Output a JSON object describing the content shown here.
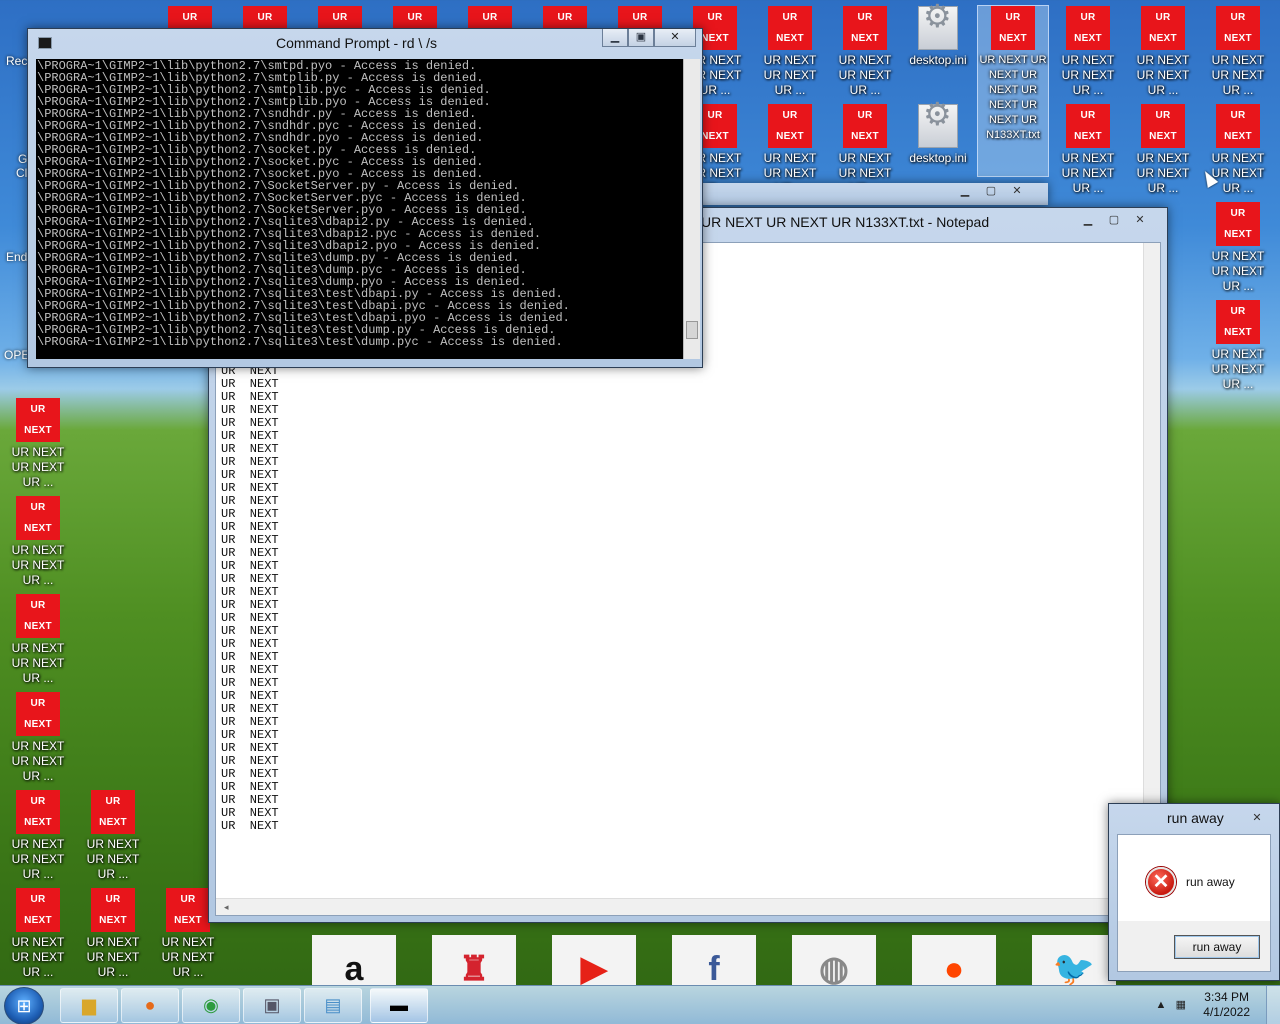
{
  "desktop": {
    "icon_label_red": "UR NEXT UR NEXT UR ...",
    "icon_text_top": "UR",
    "icon_text_bottom": "NEXT",
    "desktop_ini": "desktop.ini",
    "tall_label": "UR NEXT UR NEXT UR NEXT UR NEXT UR NEXT UR N133XT.txt",
    "partial_label_bottom_right": "UR NE NEXT",
    "edge_labels": [
      "Rec",
      "G",
      "Cl",
      "End",
      "OPE"
    ]
  },
  "cmd": {
    "title": "Command Prompt - rd  \\ /s",
    "lines": [
      "\\PROGRA~1\\GIMP2~1\\lib\\python2.7\\smtpd.pyo - Access is denied.",
      "\\PROGRA~1\\GIMP2~1\\lib\\python2.7\\smtplib.py - Access is denied.",
      "\\PROGRA~1\\GIMP2~1\\lib\\python2.7\\smtplib.pyc - Access is denied.",
      "\\PROGRA~1\\GIMP2~1\\lib\\python2.7\\smtplib.pyo - Access is denied.",
      "\\PROGRA~1\\GIMP2~1\\lib\\python2.7\\sndhdr.py - Access is denied.",
      "\\PROGRA~1\\GIMP2~1\\lib\\python2.7\\sndhdr.pyc - Access is denied.",
      "\\PROGRA~1\\GIMP2~1\\lib\\python2.7\\sndhdr.pyo - Access is denied.",
      "\\PROGRA~1\\GIMP2~1\\lib\\python2.7\\socket.py - Access is denied.",
      "\\PROGRA~1\\GIMP2~1\\lib\\python2.7\\socket.pyc - Access is denied.",
      "\\PROGRA~1\\GIMP2~1\\lib\\python2.7\\socket.pyo - Access is denied.",
      "\\PROGRA~1\\GIMP2~1\\lib\\python2.7\\SocketServer.py - Access is denied.",
      "\\PROGRA~1\\GIMP2~1\\lib\\python2.7\\SocketServer.pyc - Access is denied.",
      "\\PROGRA~1\\GIMP2~1\\lib\\python2.7\\SocketServer.pyo - Access is denied.",
      "\\PROGRA~1\\GIMP2~1\\lib\\python2.7\\sqlite3\\dbapi2.py - Access is denied.",
      "\\PROGRA~1\\GIMP2~1\\lib\\python2.7\\sqlite3\\dbapi2.pyc - Access is denied.",
      "\\PROGRA~1\\GIMP2~1\\lib\\python2.7\\sqlite3\\dbapi2.pyo - Access is denied.",
      "\\PROGRA~1\\GIMP2~1\\lib\\python2.7\\sqlite3\\dump.py - Access is denied.",
      "\\PROGRA~1\\GIMP2~1\\lib\\python2.7\\sqlite3\\dump.pyc - Access is denied.",
      "\\PROGRA~1\\GIMP2~1\\lib\\python2.7\\sqlite3\\dump.pyo - Access is denied.",
      "\\PROGRA~1\\GIMP2~1\\lib\\python2.7\\sqlite3\\test\\dbapi.py - Access is denied.",
      "\\PROGRA~1\\GIMP2~1\\lib\\python2.7\\sqlite3\\test\\dbapi.pyc - Access is denied.",
      "\\PROGRA~1\\GIMP2~1\\lib\\python2.7\\sqlite3\\test\\dbapi.pyo - Access is denied.",
      "\\PROGRA~1\\GIMP2~1\\lib\\python2.7\\sqlite3\\test\\dump.py - Access is denied.",
      "\\PROGRA~1\\GIMP2~1\\lib\\python2.7\\sqlite3\\test\\dump.pyc - Access is denied."
    ]
  },
  "notepad": {
    "title": "UR NEXT UR NEXT UR N133XT.txt - Notepad",
    "line_text": "UR  NEXT",
    "visible_line_count": 36
  },
  "dialog": {
    "title": "run away",
    "message": "run away",
    "button": "run away"
  },
  "dock": {
    "items": [
      {
        "name": "amazon",
        "glyph": "a",
        "color": "#111111"
      },
      {
        "name": "castle",
        "glyph": "♜",
        "color": "#d4232e"
      },
      {
        "name": "youtube",
        "glyph": "▶",
        "color": "#e62117"
      },
      {
        "name": "facebook",
        "glyph": "f",
        "color": "#3b5998"
      },
      {
        "name": "wikipedia",
        "glyph": "◍",
        "color": "#888888"
      },
      {
        "name": "reddit",
        "glyph": "●",
        "color": "#ff4500"
      },
      {
        "name": "twitter",
        "glyph": "🐦",
        "color": "#1da1f2"
      }
    ]
  },
  "taskbar": {
    "time": "3:34 PM",
    "date": "4/1/2022",
    "buttons": [
      "explorer",
      "firefox",
      "chrome",
      "app-window",
      "notepad",
      "cmd"
    ]
  },
  "colors": {
    "icon_red": "#e8151b",
    "console_bg": "#000000",
    "console_fg": "#c0c0c0"
  }
}
